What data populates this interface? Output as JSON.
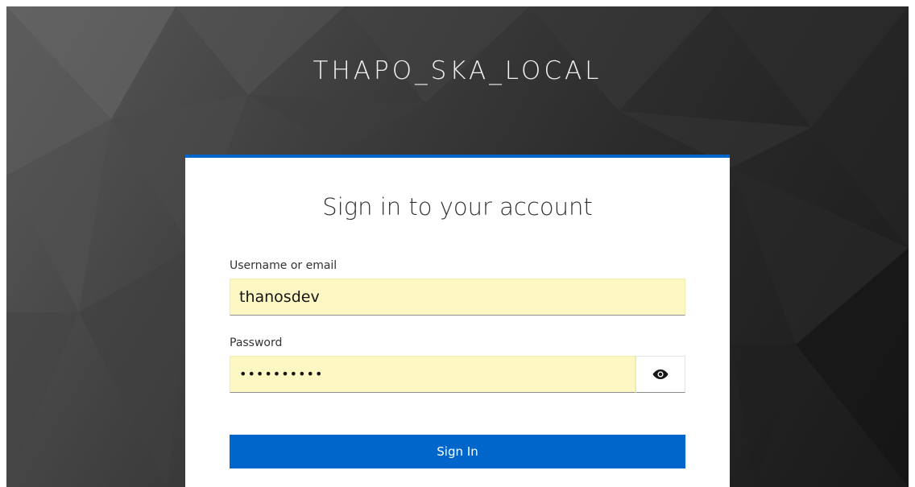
{
  "realm": {
    "title": "THAPO_SKA_LOCAL"
  },
  "login_card": {
    "title": "Sign in to your account",
    "username": {
      "label": "Username or email",
      "value": "thanosdev"
    },
    "password": {
      "label": "Password",
      "masked_value": "••••••••••",
      "toggle_icon": "eye-icon"
    },
    "submit_label": "Sign In"
  },
  "colors": {
    "accent": "#0066cc",
    "autofill": "#fdf7c3",
    "background_dark": "#1a1a1a"
  }
}
